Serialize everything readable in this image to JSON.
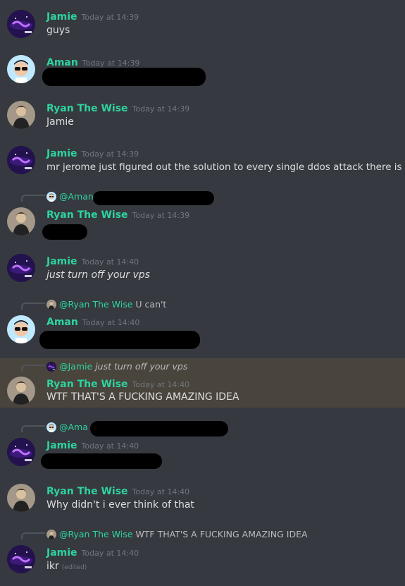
{
  "messages": [
    {
      "author": "Jamie",
      "time": "Today at 14:39",
      "text": "guys"
    },
    {
      "author": "Aman",
      "time": "Today at 14:39",
      "text": ""
    },
    {
      "author": "Ryan The Wise",
      "time": "Today at 14:39",
      "text": "Jamie"
    },
    {
      "author": "Jamie",
      "time": "Today at 14:39",
      "text": "mr jerome just figured out the solution to every single ddos attack there is"
    },
    {
      "author": "Ryan The Wise",
      "time": "Today at 14:39",
      "text": "",
      "reply_mention": "@Aman",
      "reply_text": ""
    },
    {
      "author": "Jamie",
      "time": "Today at 14:40",
      "text": "just turn off your vps"
    },
    {
      "author": "Aman",
      "time": "Today at 14:40",
      "text": "",
      "reply_mention": "@Ryan The Wise",
      "reply_text": "U can't"
    },
    {
      "author": "Ryan The Wise",
      "time": "Today at 14:40",
      "text": "WTF THAT'S A FUCKING AMAZING IDEA",
      "reply_mention": "@Jamie",
      "reply_text": "just turn off your vps"
    },
    {
      "author": "Jamie",
      "time": "Today at 14:40",
      "text": "",
      "reply_mention": "@Ama",
      "reply_text": ""
    },
    {
      "author": "Ryan The Wise",
      "time": "Today at 14:40",
      "text": "Why didn't i ever think of that"
    },
    {
      "author": "Jamie",
      "time": "Today at 14:40",
      "text": "ikr",
      "edited": "(edited)",
      "reply_mention": "@Ryan The Wise",
      "reply_text": "WTF THAT'S A FUCKING AMAZING IDEA"
    }
  ],
  "colors": {
    "background": "#36393f",
    "username": "#2ed3a0",
    "timestamp": "#72767d",
    "message_text": "#dcddde",
    "highlight": "#49443c",
    "redaction": "#000000"
  },
  "icons": {
    "jamie_avatar": "purple-galaxy-avatar-icon",
    "aman_avatar": "cartoon-sunglasses-avatar-icon",
    "ryan_avatar": "person-photo-avatar-icon"
  }
}
